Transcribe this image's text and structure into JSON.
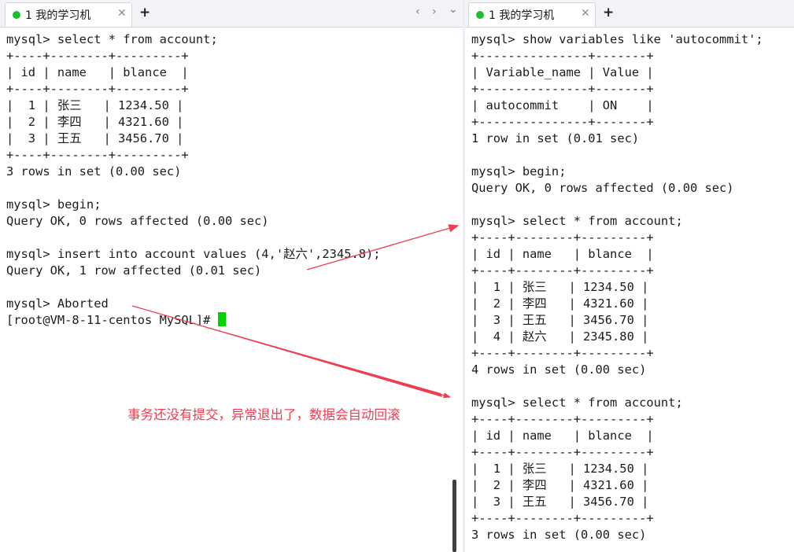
{
  "left_pane": {
    "tab": {
      "title": "1 我的学习机",
      "close_glyph": "✕",
      "add_glyph": "+"
    },
    "nav": {
      "prev": "‹",
      "next": "›",
      "menu": "⌄"
    },
    "lines": [
      "mysql> select * from account;",
      "+----+--------+---------+",
      "| id | name   | blance  |",
      "+----+--------+---------+",
      "|  1 | 张三   | 1234.50 |",
      "|  2 | 李四   | 4321.60 |",
      "|  3 | 王五   | 3456.70 |",
      "+----+--------+---------+",
      "3 rows in set (0.00 sec)",
      "",
      "mysql> begin;",
      "Query OK, 0 rows affected (0.00 sec)",
      "",
      "mysql> insert into account values (4,'赵六',2345.8);",
      "Query OK, 1 row affected (0.01 sec)",
      "",
      "mysql> Aborted"
    ],
    "prompt": "[root@VM-8-11-centos MySQL]# "
  },
  "right_pane": {
    "tab": {
      "title": "1 我的学习机",
      "close_glyph": "✕",
      "add_glyph": "+"
    },
    "lines": [
      "mysql> show variables like 'autocommit';",
      "+---------------+-------+",
      "| Variable_name | Value |",
      "+---------------+-------+",
      "| autocommit    | ON    |",
      "+---------------+-------+",
      "1 row in set (0.01 sec)",
      "",
      "mysql> begin;",
      "Query OK, 0 rows affected (0.00 sec)",
      "",
      "mysql> select * from account;",
      "+----+--------+---------+",
      "| id | name   | blance  |",
      "+----+--------+---------+",
      "|  1 | 张三   | 1234.50 |",
      "|  2 | 李四   | 4321.60 |",
      "|  3 | 王五   | 3456.70 |",
      "|  4 | 赵六   | 2345.80 |",
      "+----+--------+---------+",
      "4 rows in set (0.00 sec)",
      "",
      "mysql> select * from account;",
      "+----+--------+---------+",
      "| id | name   | blance  |",
      "+----+--------+---------+",
      "|  1 | 张三   | 1234.50 |",
      "|  2 | 李四   | 4321.60 |",
      "|  3 | 王五   | 3456.70 |",
      "+----+--------+---------+",
      "3 rows in set (0.00 sec)"
    ]
  },
  "annotation": {
    "text": "事务还没有提交，异常退出了，数据会自动回滚",
    "color": "#f03c4f"
  },
  "colors": {
    "tab_dot": "#1fbd2f",
    "cursor": "#00d200",
    "arrow": "#f03c4f"
  }
}
